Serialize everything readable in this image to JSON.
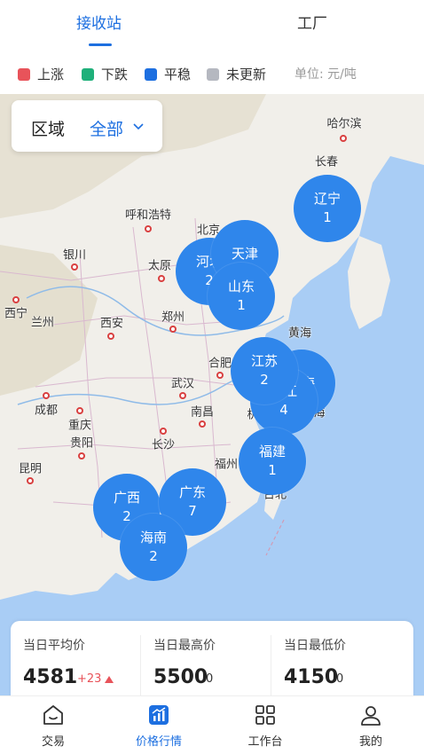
{
  "tabs": [
    {
      "label": "接收站",
      "active": true
    },
    {
      "label": "工厂",
      "active": false
    }
  ],
  "legend": {
    "items": [
      {
        "label": "上涨",
        "color": "#e8535a"
      },
      {
        "label": "下跌",
        "color": "#1fb07a"
      },
      {
        "label": "平稳",
        "color": "#1d6fe0"
      },
      {
        "label": "未更新",
        "color": "#b5b8c0"
      }
    ],
    "unit": "单位: 元/吨"
  },
  "region_filter": {
    "label": "区域",
    "value": "全部"
  },
  "map": {
    "cities": [
      "哈尔滨",
      "长春",
      "呼和浩特",
      "北京",
      "银川",
      "太原",
      "兰州",
      "西宁",
      "西安",
      "郑州",
      "黄海",
      "合肥",
      "武汉",
      "成都",
      "重庆",
      "贵阳",
      "南昌",
      "长沙",
      "福州",
      "台北",
      "昆明",
      "杭",
      "海"
    ],
    "bubbles": [
      {
        "name": "辽宁",
        "count": "1"
      },
      {
        "name": "天津",
        "count": ""
      },
      {
        "name": "河北",
        "count": "2"
      },
      {
        "name": "山东",
        "count": "1"
      },
      {
        "name": "江苏",
        "count": "2"
      },
      {
        "name": "上海",
        "count": ""
      },
      {
        "name": "浙江",
        "count": "4"
      },
      {
        "name": "福建",
        "count": "1"
      },
      {
        "name": "广西",
        "count": "2"
      },
      {
        "name": "广东",
        "count": "7"
      },
      {
        "name": "海南",
        "count": "2"
      }
    ]
  },
  "stats": [
    {
      "label": "当日平均价",
      "value": "4581",
      "delta": "+23",
      "delta_color": "#e8535a",
      "trend": "up"
    },
    {
      "label": "当日最高价",
      "value": "5500",
      "delta": "0",
      "delta_color": "#333333",
      "trend": "none"
    },
    {
      "label": "当日最低价",
      "value": "4150",
      "delta": "0",
      "delta_color": "#333333",
      "trend": "none"
    }
  ],
  "bottom_nav": [
    {
      "label": "交易",
      "icon": "home-icon",
      "active": false
    },
    {
      "label": "价格行情",
      "icon": "chart-icon",
      "active": true
    },
    {
      "label": "工作台",
      "icon": "grid-icon",
      "active": false
    },
    {
      "label": "我的",
      "icon": "user-icon",
      "active": false
    }
  ]
}
